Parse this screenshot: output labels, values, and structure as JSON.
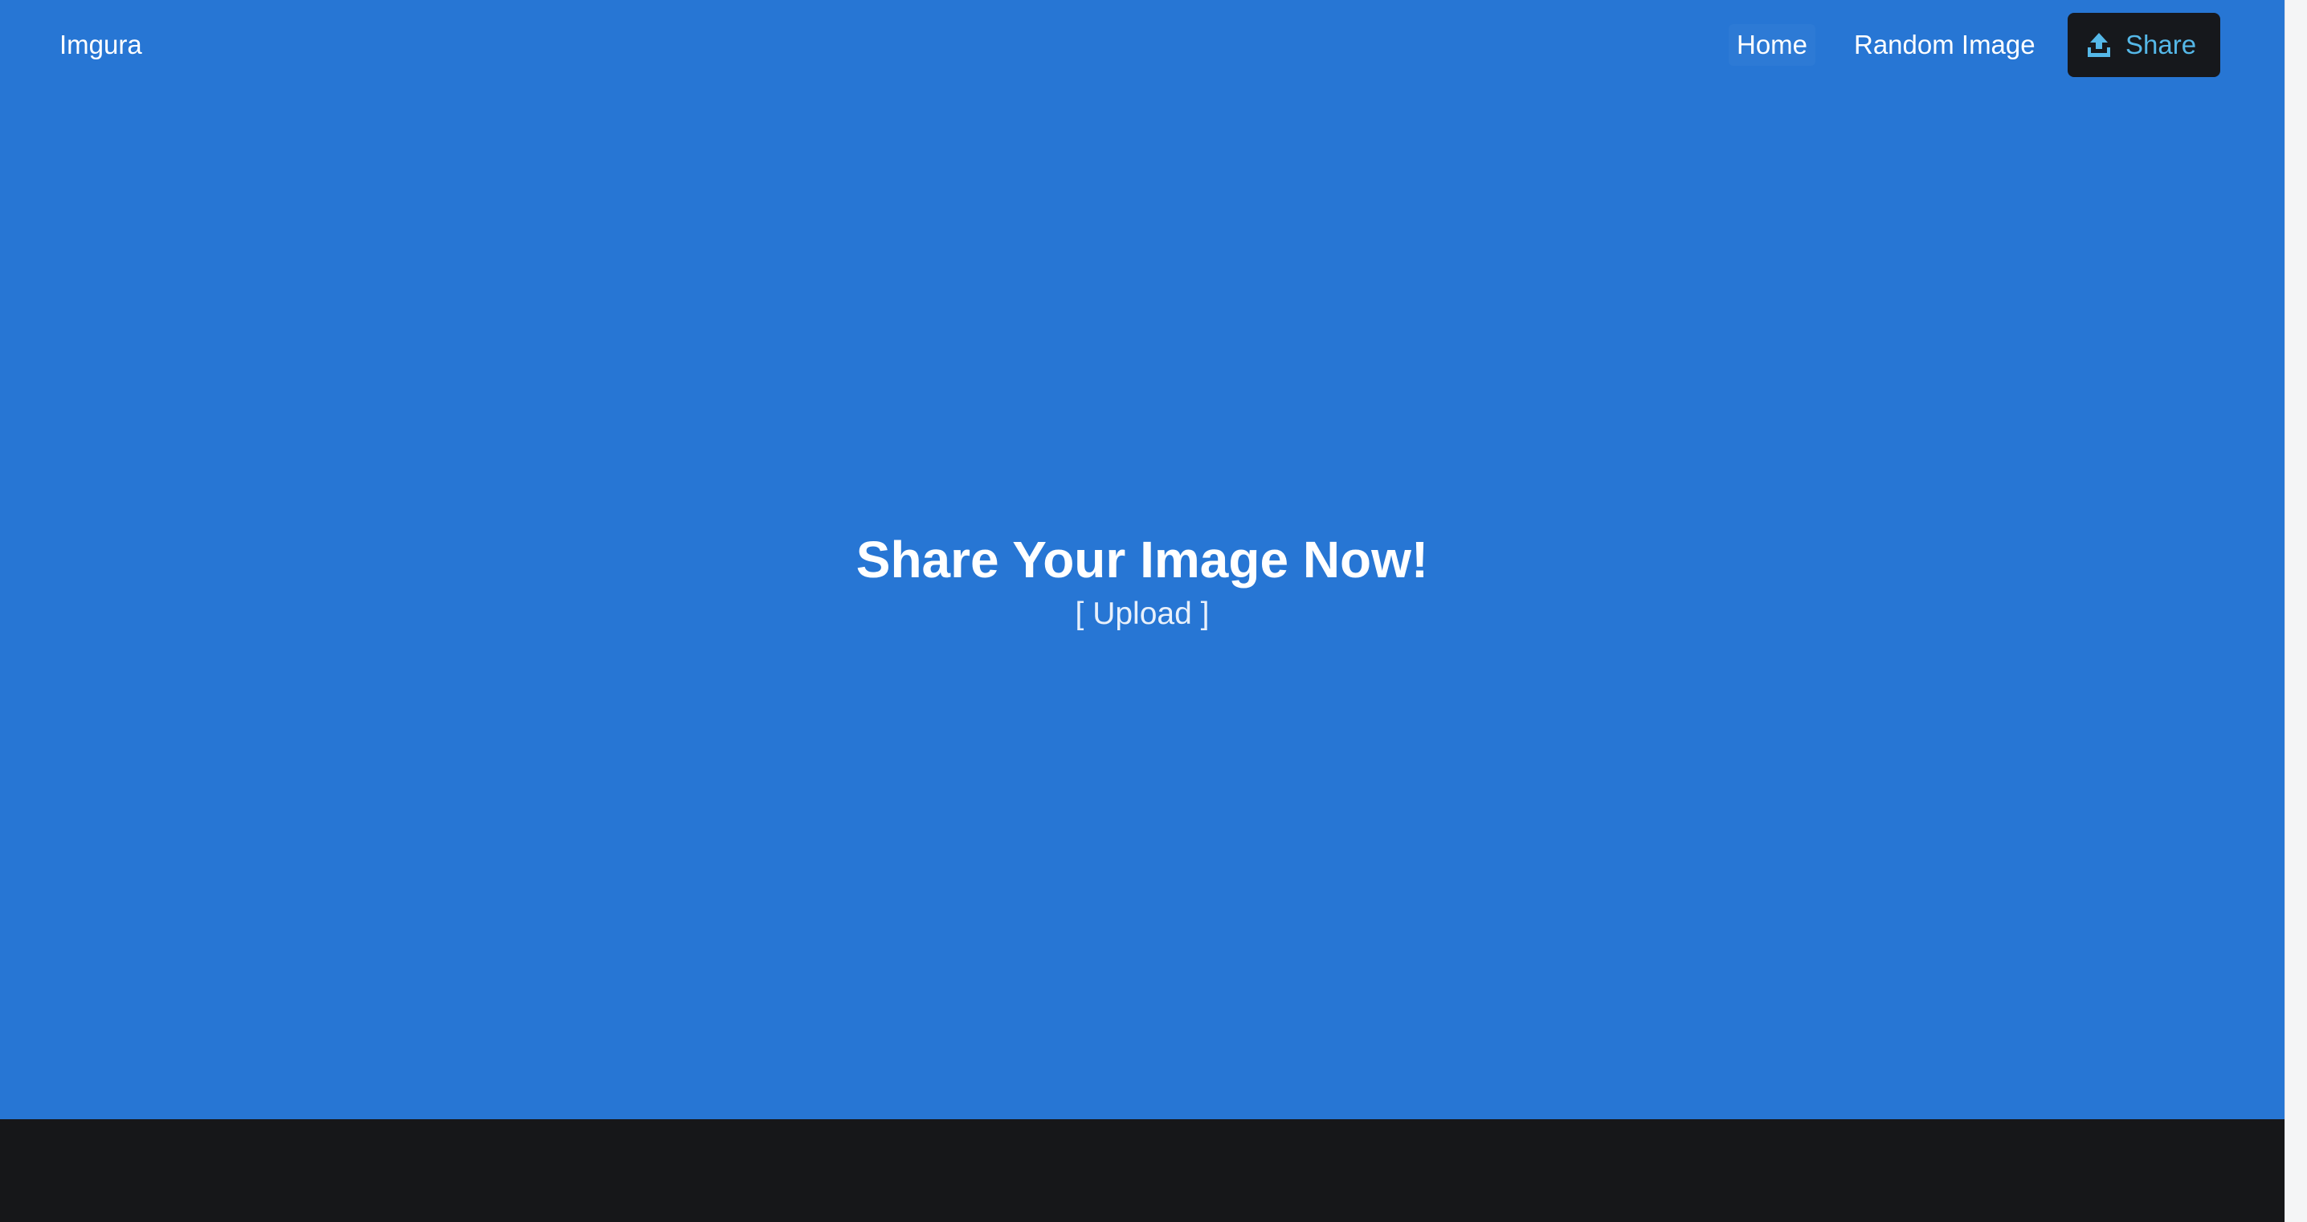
{
  "navbar": {
    "brand": "Imgura",
    "links": [
      {
        "label": "Home"
      },
      {
        "label": "Random Image"
      }
    ],
    "share_button": {
      "label": "Share",
      "icon": "upload-icon"
    }
  },
  "hero": {
    "title": "Share Your Image Now!",
    "upload_link": "[ Upload ]"
  },
  "colors": {
    "primary_blue": "#2776d4",
    "dark": "#161719",
    "share_accent": "#55b8e8"
  }
}
